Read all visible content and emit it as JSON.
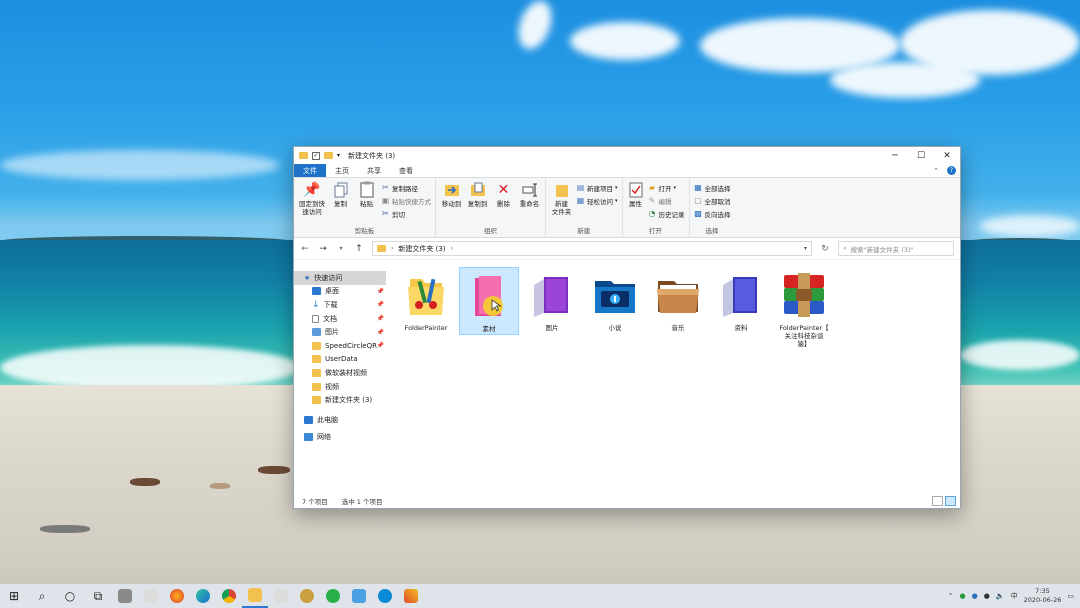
{
  "window": {
    "title": "新建文件夹 (3)",
    "minimize": "─",
    "maximize": "☐",
    "close": "✕"
  },
  "ribbon_tabs": [
    {
      "label": "文件",
      "active": true
    },
    {
      "label": "主页"
    },
    {
      "label": "共享"
    },
    {
      "label": "查看"
    }
  ],
  "ribbon": {
    "clipboard": {
      "label": "剪贴板",
      "pin_quick": "固定到快\n速访问",
      "copy": "复制",
      "paste": "粘贴",
      "copy_path": "复制路径",
      "paste_shortcut": "粘贴快捷方式",
      "cut": "剪切"
    },
    "organize": {
      "label": "组织",
      "move_to": "移动到",
      "copy_to": "复制到",
      "delete": "删除",
      "rename": "重命名"
    },
    "new": {
      "label": "新建",
      "new_folder": "新建\n文件夹",
      "new_item": "新建项目",
      "easy_access": "轻松访问"
    },
    "open": {
      "label": "打开",
      "properties": "属性",
      "open": "打开",
      "edit": "编辑",
      "history": "历史记录"
    },
    "select": {
      "label": "选择",
      "select_all": "全部选择",
      "select_none": "全部取消",
      "invert": "反向选择"
    }
  },
  "address": {
    "path": "新建文件夹 (3)",
    "search_placeholder": "搜索\"新建文件夹 (3)\""
  },
  "nav": {
    "quick_access": "快速访问",
    "items": [
      {
        "label": "桌面",
        "pinned": true
      },
      {
        "label": "下载",
        "pinned": true
      },
      {
        "label": "文档",
        "pinned": true
      },
      {
        "label": "图片",
        "pinned": true
      },
      {
        "label": "SpeedCircleQR",
        "pinned": true
      },
      {
        "label": "UserData"
      },
      {
        "label": "做软装材视频"
      },
      {
        "label": "视频"
      },
      {
        "label": "新建文件夹 (3)"
      }
    ],
    "this_pc": "此电脑",
    "network": "网络"
  },
  "files": [
    {
      "name": "FolderPainter",
      "type": "painter"
    },
    {
      "name": "素材",
      "type": "pink",
      "selected": true
    },
    {
      "name": "图片",
      "type": "purple"
    },
    {
      "name": "小说",
      "type": "blue-info"
    },
    {
      "name": "音乐",
      "type": "brown"
    },
    {
      "name": "资料",
      "type": "indigo"
    },
    {
      "name": "FolderPainter【\n关注科技杂谈\n猿】",
      "type": "rar"
    }
  ],
  "status": {
    "count": "7 个项目",
    "selected": "选中 1 个项目"
  },
  "taskbar": {
    "tray_text": "中",
    "time": "7:35",
    "date": "2020-06-26"
  }
}
